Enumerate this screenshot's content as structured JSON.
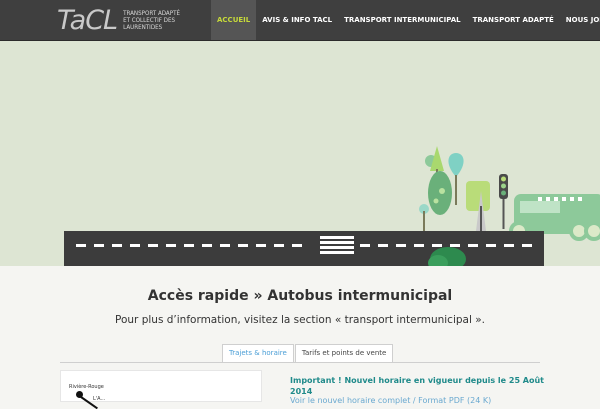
{
  "header": {
    "logo_mark": "TaCL",
    "logo_text": "TRANSPORT ADAPTÉ ET COLLECTIF DES LAURENTIDES",
    "nav": [
      {
        "label": "ACCUEIL",
        "active": true
      },
      {
        "label": "AVIS & INFO TACL",
        "active": false
      },
      {
        "label": "TRANSPORT INTERMUNICIPAL",
        "active": false
      },
      {
        "label": "TRANSPORT ADAPTÉ",
        "active": false
      },
      {
        "label": "NOUS JOINDRE",
        "active": false
      }
    ]
  },
  "main": {
    "heading": "Accès rapide » Autobus intermunicipal",
    "subheading": "Pour plus d’information, visitez la section « transport intermunicipal ».",
    "tabs": [
      {
        "label": "Trajets & horaire",
        "active": true
      },
      {
        "label": "Tarifs et points de vente",
        "active": false
      }
    ],
    "map_labels": [
      "Rivière-Rouge",
      "L'A..."
    ],
    "notice_title": "Important ! Nouvel horaire en vigueur depuis le 25 Août 2014",
    "notice_link": "Voir le nouvel horaire complet / Format PDF (24 K)"
  },
  "colors": {
    "header_bg": "#3f3f3f",
    "nav_active_text": "#c6d93a",
    "hero_bg": "#dde5d3",
    "road": "#3c3c3c",
    "bus": "#8dc99a",
    "notice": "#1f8a8a",
    "tab_active": "#4a9ed6"
  }
}
